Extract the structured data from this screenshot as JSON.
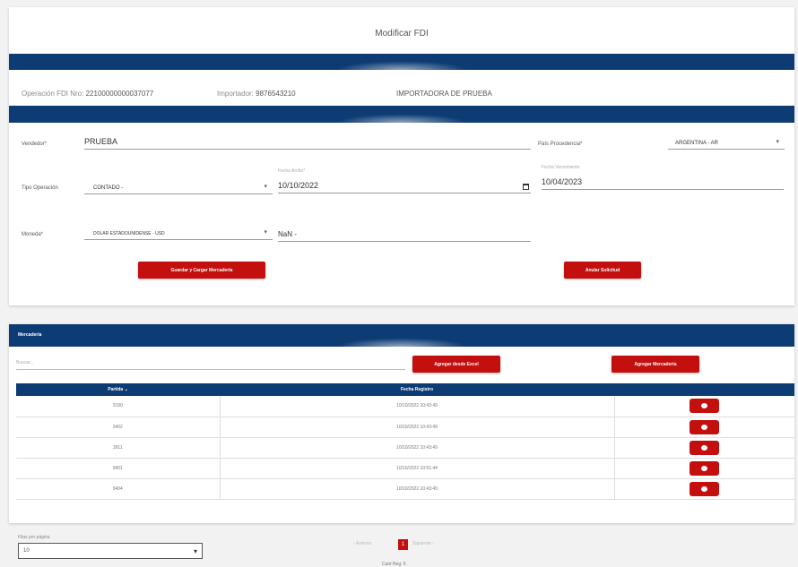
{
  "header": {
    "title": "Modificar FDI"
  },
  "info": {
    "operacion_label": "Operación FDI Nro:",
    "operacion_value": "22100000000037077",
    "importador_label": "Importador:",
    "importador_value": "9876543210",
    "importador_name": "IMPORTADORA DE PRUEBA"
  },
  "form": {
    "vendedor_label": "Vendedor*",
    "vendedor_value": "PRUEBA",
    "pais_label": "País Procedencia*",
    "pais_value": "ARGENTINA - AR",
    "tipo_label": "Tipo Operación",
    "tipo_value": "CONTADO -",
    "fecha_arribo_label": "Fecha Arribo*",
    "fecha_arribo_value": "10/10/2022",
    "fecha_venc_label": "Fecha Vencimiento",
    "fecha_venc_value": "10/04/2023",
    "moneda_label": "Moneda*",
    "moneda_value": "DOLAR ESTADOUNIDENSE - USD",
    "monto_value": "NaN -",
    "guardar_button": "Guardar y Cargar Mercadería",
    "anular_button": "Anular Solicitud"
  },
  "mercaderia": {
    "title": "Mercadería",
    "search_placeholder": "Buscar...",
    "excel_button": "Agregar desde Excel",
    "add_button": "Agregar Mercadería",
    "columns": [
      "Partida ⌄",
      "Fecha Registro",
      ""
    ],
    "rows": [
      {
        "partida": "3190",
        "fecha": "10/10/2022 10:43:49"
      },
      {
        "partida": "3402",
        "fecha": "10/10/2022 10:43:49"
      },
      {
        "partida": "3911",
        "fecha": "10/10/2022 10:43:49"
      },
      {
        "partida": "9401",
        "fecha": "10/10/2022 10:51:44"
      },
      {
        "partida": "9404",
        "fecha": "10/10/2022 10:43:49"
      }
    ]
  },
  "pagination": {
    "per_page_label": "Filas por página",
    "per_page_value": "10",
    "prev": "‹ Anterior",
    "current_page": "1",
    "next": "Siguiente ›",
    "page_count": "Cant Reg: 5"
  },
  "colors": {
    "primary": "#0d3b73",
    "accent": "#c40f0f"
  }
}
